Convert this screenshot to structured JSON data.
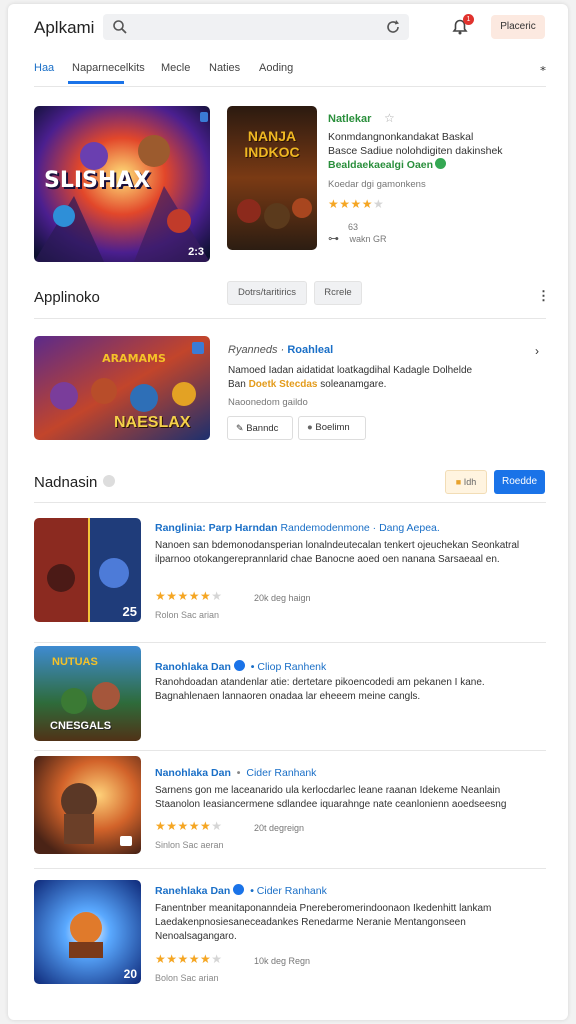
{
  "header": {
    "title": "Aplkami",
    "notification_count": "1",
    "action_button": "Placeric"
  },
  "tabs": [
    {
      "label": "Haa"
    },
    {
      "label": "Naparnecelkits"
    },
    {
      "label": "Mecle"
    },
    {
      "label": "Naties"
    },
    {
      "label": "Aoding"
    }
  ],
  "featured": {
    "thumb1_title": "SLISHAX",
    "thumb1_badge": "2:3",
    "thumb2_title": "NANJA INDKOC",
    "title": "Natlekar",
    "desc_line1": "Konmdangnonkandakat Baskal",
    "desc_line2": "Basce Sadiue nolohdigiten dakinshek",
    "desc_green": "Bealdaekaealgi Oaen",
    "meta": "Koedar dgi gamonkens",
    "rating": 4,
    "info_count": "63",
    "info_size": "wakn GR"
  },
  "apps_section": {
    "title": "Applinoko",
    "chip1": "Dotrs/taritirics",
    "chip2": "Rcrele",
    "thumb_title": "NAESLAX",
    "line1_italic": "Ryanneds ·",
    "line1_blue": "Roahleal",
    "desc_a": "Namoed Iadan aidatidat loatkagdihal Kadagle Dolhelde",
    "desc_b_prefix": "Ban",
    "desc_orange": "Doetk Stecdas",
    "desc_b_suffix": "soleanamgare.",
    "meta": "Naoonedom gaildo",
    "btn1": "Banndc",
    "btn2": "Boelimn"
  },
  "reviews_section": {
    "title": "Nadnasin",
    "btn_small": "Idh",
    "btn_primary": "Roedde"
  },
  "list": [
    {
      "title": "Ranglinia: Parp Harndan",
      "subtitle": "Randemodenmone · Dang Aepea.",
      "body": "Nanoen san bdemonodansperian lonalndeutecalan tenkert ojeuchekan Seonkatral ilparnoo otokangereprannlarid chae Banocne aoed oen nanana Sarsaeaal en.",
      "rating": 5,
      "reviews": "20k deg haign",
      "author": "Rolon Sac arian",
      "badge": "25"
    },
    {
      "title": "Ranohlaka Dan",
      "subtitle": "Cliop Ranhenk",
      "body": "Ranohdoadan atandenlar atie: dertetare pikoencodedi am pekanen I kane. Bagnahlenaen lannaoren onadaa lar eheeem meine cangls.",
      "rating": null,
      "reviews": "",
      "author": "",
      "badge": "CNESGALS"
    },
    {
      "title": "Nanohlaka Dan",
      "subtitle": "Cider Ranhank",
      "body": "Sarnens gon me laceanarido ula kerlocdarlec leane raanan Idekeme Neanlain Staanolon Ieasiancermene sdlandee iquarahnge nate ceanlonienn aoedseesng",
      "rating": 5,
      "reviews": "20t degreign",
      "author": "Sinlon Sac aeran",
      "badge": ""
    },
    {
      "title": "Ranehlaka Dan",
      "subtitle": "Cider Ranhank",
      "body": "Fanentnber meanitaponanndeia Pnereberomerindoonaon Ikedenhitt lankam Laedakenpnosiesaneceadankes Renedarme Neranie Mentangonseen Nenoalsagangaro.",
      "rating": 5,
      "reviews": "10k deg Regn",
      "author": "Bolon Sac arian",
      "badge": "20"
    }
  ],
  "colors": {
    "accent": "#1a73e8",
    "green": "#2a8f3c",
    "star": "#f5a623",
    "badge_red": "#e0322d"
  }
}
